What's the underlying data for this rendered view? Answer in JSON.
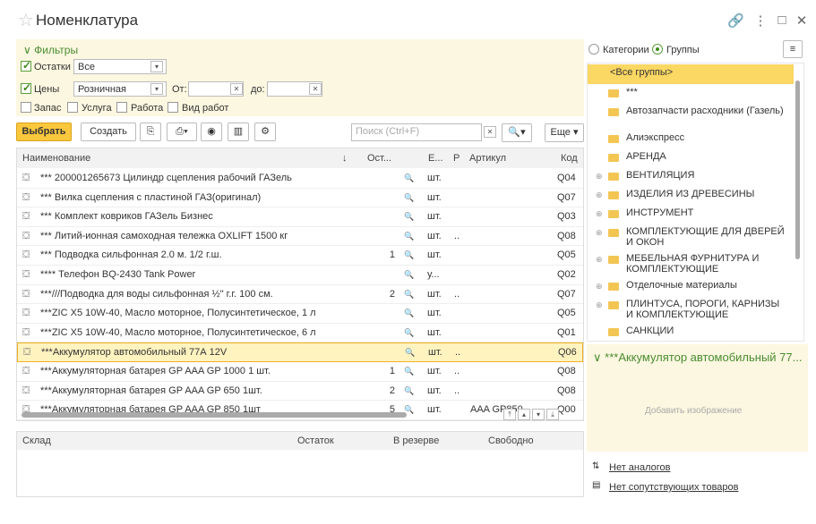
{
  "window": {
    "title": "Номенклатура",
    "controls": [
      "link",
      "more",
      "maximize",
      "close"
    ]
  },
  "filters": {
    "header": "Фильтры",
    "ostatki": {
      "label": "Остатки",
      "value": "Все",
      "checked": true
    },
    "ceny": {
      "label": "Цены",
      "value": "Розничная",
      "checked": true,
      "from_label": "От:",
      "to_label": "до:"
    },
    "zapas": "Запас",
    "usluga": "Услуга",
    "rabota": "Работа",
    "vid_rabot": "Вид работ"
  },
  "toolbar": {
    "select": "Выбрать",
    "create": "Создать",
    "search_placeholder": "Поиск (Ctrl+F)",
    "more": "Еще"
  },
  "grid": {
    "columns": [
      "Наименование",
      "↓",
      "Ост...",
      "",
      "Е...",
      "Р",
      "Артикул",
      "Код"
    ],
    "rows": [
      {
        "name": "*** 200001265673 Цилиндр сцепления рабочий ГАЗель",
        "ost": "",
        "unit": "шт.",
        "r": "",
        "art": "",
        "code": "Q04"
      },
      {
        "name": "*** Вилка сцепления с пластиной ГАЗ(оригинал)",
        "ost": "",
        "unit": "шт.",
        "r": "",
        "art": "",
        "code": "Q07"
      },
      {
        "name": "*** Комплект ковриков ГАЗель Бизнес",
        "ost": "",
        "unit": "шт.",
        "r": "",
        "art": "",
        "code": "Q03"
      },
      {
        "name": "*** Литий-ионная самоходная тележка OXLIFT 1500 кг",
        "ost": "",
        "unit": "шт.",
        "r": "..",
        "art": "",
        "code": "Q08"
      },
      {
        "name": "*** Подводка сильфонная 2.0 м. 1/2 г.ш.",
        "ost": "1",
        "unit": "шт.",
        "r": "",
        "art": "",
        "code": "Q05"
      },
      {
        "name": "**** Телефон BQ-2430 Tank Power",
        "ost": "",
        "unit": "у...",
        "r": "",
        "art": "",
        "code": "Q02"
      },
      {
        "name": "***///Подводка для воды сильфонная ½\"  г.г. 100 см.",
        "ost": "2",
        "unit": "шт.",
        "r": "..",
        "art": "",
        "code": "Q07"
      },
      {
        "name": "***ZIC X5 10W-40, Масло моторное, Полусинтетическое, 1 л",
        "ost": "",
        "unit": "шт.",
        "r": "",
        "art": "",
        "code": "Q05"
      },
      {
        "name": "***ZIC X5 10W-40, Масло моторное, Полусинтетическое, 6 л",
        "ost": "",
        "unit": "шт.",
        "r": "",
        "art": "",
        "code": "Q01"
      },
      {
        "name": "***Аккумулятор автомобильный 77А 12V",
        "ost": "",
        "unit": "шт.",
        "r": "..",
        "art": "",
        "code": "Q06"
      },
      {
        "name": "***Аккумуляторная батарея GP AAA GP 1000 1 шт.",
        "ost": "1",
        "unit": "шт.",
        "r": "..",
        "art": "",
        "code": "Q08"
      },
      {
        "name": "***Аккумуляторная батарея GP AAA GP 650  1шт.",
        "ost": "2",
        "unit": "шт.",
        "r": "..",
        "art": "",
        "code": "Q08"
      },
      {
        "name": "***Аккумуляторная батарея GP AAA GP 850 1шт",
        "ost": "5",
        "unit": "шт.",
        "r": "",
        "art": "AAA GP850",
        "code": "Q00"
      }
    ],
    "selected_index": 9
  },
  "bottom": {
    "columns": [
      "Склад",
      "Остаток",
      "В резерве",
      "Свободно"
    ]
  },
  "right": {
    "radio_categories": "Категории",
    "radio_groups": "Группы",
    "groups": [
      {
        "label": "<Все группы>",
        "expandable": false,
        "folder": false,
        "selected": true
      },
      {
        "label": "***",
        "expandable": false,
        "folder": true
      },
      {
        "label": "Автозапчасти расходники (Газель)",
        "expandable": false,
        "folder": true
      },
      {
        "label": "Алиэкспресс",
        "expandable": false,
        "folder": true
      },
      {
        "label": "АРЕНДА",
        "expandable": false,
        "folder": true
      },
      {
        "label": "ВЕНТИЛЯЦИЯ",
        "expandable": true,
        "folder": true
      },
      {
        "label": "ИЗДЕЛИЯ ИЗ ДРЕВЕСИНЫ",
        "expandable": true,
        "folder": true
      },
      {
        "label": "ИНСТРУМЕНТ",
        "expandable": true,
        "folder": true
      },
      {
        "label": "КОМПЛЕКТУЮЩИЕ ДЛЯ ДВЕРЕЙ И ОКОН",
        "expandable": true,
        "folder": true
      },
      {
        "label": "МЕБЕЛЬНАЯ ФУРНИТУРА И КОМПЛЕКТУЮЩИЕ",
        "expandable": true,
        "folder": true
      },
      {
        "label": "Отделочные материалы",
        "expandable": true,
        "folder": true
      },
      {
        "label": "ПЛИНТУСА, ПОРОГИ, КАРНИЗЫ И КОМПЛЕКТУЮЩИЕ",
        "expandable": true,
        "folder": true
      },
      {
        "label": "САНКЦИИ",
        "expandable": false,
        "folder": true
      }
    ],
    "detail_title": "***Аккумулятор автомобильный 77...",
    "add_image": "Добавить изображение",
    "no_analogs": "Нет аналогов",
    "no_related": "Нет сопутствующих товаров"
  },
  "colors": {
    "accent": "#fbc73d",
    "green": "#4a8c32",
    "filter_bg": "#fcf7e0"
  }
}
